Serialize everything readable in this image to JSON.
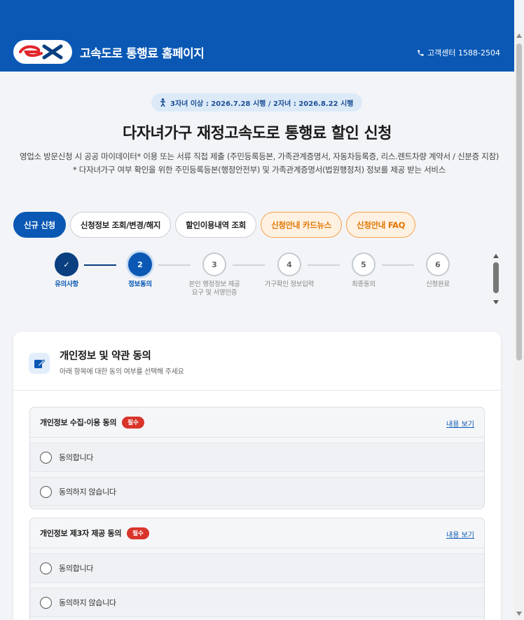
{
  "header": {
    "logo_text": "ex",
    "site_title": "고속도로 통행료 홈페이지",
    "phone_label": "고객센터 1588-2504"
  },
  "notice": {
    "text": "3자녀 이상 : 2026.7.28 시행 / 2자녀 : 2026.8.22 시행"
  },
  "page": {
    "title": "다자녀가구 재정고속도로 통행료 할인 신청",
    "description": "영업소 방문신청 시 공공 마이데이터* 이용 또는 서류 직접 제출 (주민등록등본, 가족관계증명서, 자동차등록증, 리스.렌트차량 계약서 / 신분증 지참)",
    "note": "* 다자녀가구 여부 확인을 위한 주민등록등본(행정안전부) 및 가족관계증명서(법원행정처) 정보를 제공 받는 서비스"
  },
  "tabs": [
    {
      "label": "신규 신청",
      "state": "active"
    },
    {
      "label": "신청정보 조회/변경/해지",
      "state": "normal"
    },
    {
      "label": "할인이용내역 조회",
      "state": "normal"
    },
    {
      "label": "신청안내 카드뉴스",
      "state": "orange"
    },
    {
      "label": "신청안내 FAQ",
      "state": "orange"
    }
  ],
  "steps": [
    {
      "number": "✓",
      "label": "유의사항",
      "state": "done"
    },
    {
      "number": "2",
      "label": "정보동의",
      "state": "current"
    },
    {
      "number": "3",
      "label": "본인 행정정보 제공 요구 및 서명인증",
      "state": "pending"
    },
    {
      "number": "4",
      "label": "가구확인 정보입력",
      "state": "pending"
    },
    {
      "number": "5",
      "label": "최종동의",
      "state": "pending"
    },
    {
      "number": "6",
      "label": "신청완료",
      "state": "pending"
    }
  ],
  "card": {
    "title": "개인정보 및 약관 동의",
    "subtitle": "아래 항목에 대한 동의 여부를 선택해 주세요",
    "consents": [
      {
        "title": "개인정보 수집·이용 동의",
        "badge": "필수",
        "link": "내용 보기",
        "options": [
          "동의합니다",
          "동의하지 않습니다"
        ]
      },
      {
        "title": "개인정보 제3자 제공 동의",
        "badge": "필수",
        "link": "내용 보기",
        "options": [
          "동의합니다",
          "동의하지 않습니다"
        ]
      }
    ]
  },
  "colors": {
    "primary": "#0a58b4",
    "brand_red": "#e0262b",
    "orange": "#e07600",
    "badge_red": "#d9342b"
  }
}
